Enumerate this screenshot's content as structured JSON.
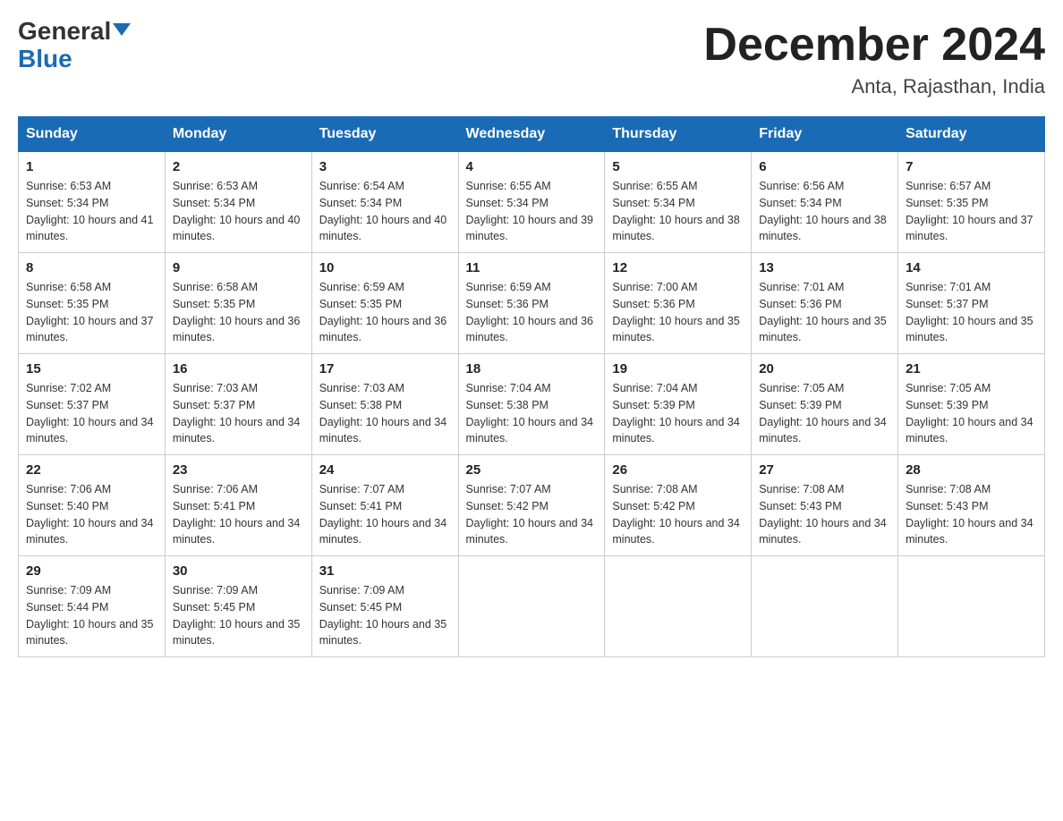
{
  "header": {
    "logo_general": "General",
    "logo_blue": "Blue",
    "month_title": "December 2024",
    "location": "Anta, Rajasthan, India"
  },
  "days_of_week": [
    "Sunday",
    "Monday",
    "Tuesday",
    "Wednesday",
    "Thursday",
    "Friday",
    "Saturday"
  ],
  "weeks": [
    [
      {
        "day": "1",
        "sunrise": "6:53 AM",
        "sunset": "5:34 PM",
        "daylight": "10 hours and 41 minutes."
      },
      {
        "day": "2",
        "sunrise": "6:53 AM",
        "sunset": "5:34 PM",
        "daylight": "10 hours and 40 minutes."
      },
      {
        "day": "3",
        "sunrise": "6:54 AM",
        "sunset": "5:34 PM",
        "daylight": "10 hours and 40 minutes."
      },
      {
        "day": "4",
        "sunrise": "6:55 AM",
        "sunset": "5:34 PM",
        "daylight": "10 hours and 39 minutes."
      },
      {
        "day": "5",
        "sunrise": "6:55 AM",
        "sunset": "5:34 PM",
        "daylight": "10 hours and 38 minutes."
      },
      {
        "day": "6",
        "sunrise": "6:56 AM",
        "sunset": "5:34 PM",
        "daylight": "10 hours and 38 minutes."
      },
      {
        "day": "7",
        "sunrise": "6:57 AM",
        "sunset": "5:35 PM",
        "daylight": "10 hours and 37 minutes."
      }
    ],
    [
      {
        "day": "8",
        "sunrise": "6:58 AM",
        "sunset": "5:35 PM",
        "daylight": "10 hours and 37 minutes."
      },
      {
        "day": "9",
        "sunrise": "6:58 AM",
        "sunset": "5:35 PM",
        "daylight": "10 hours and 36 minutes."
      },
      {
        "day": "10",
        "sunrise": "6:59 AM",
        "sunset": "5:35 PM",
        "daylight": "10 hours and 36 minutes."
      },
      {
        "day": "11",
        "sunrise": "6:59 AM",
        "sunset": "5:36 PM",
        "daylight": "10 hours and 36 minutes."
      },
      {
        "day": "12",
        "sunrise": "7:00 AM",
        "sunset": "5:36 PM",
        "daylight": "10 hours and 35 minutes."
      },
      {
        "day": "13",
        "sunrise": "7:01 AM",
        "sunset": "5:36 PM",
        "daylight": "10 hours and 35 minutes."
      },
      {
        "day": "14",
        "sunrise": "7:01 AM",
        "sunset": "5:37 PM",
        "daylight": "10 hours and 35 minutes."
      }
    ],
    [
      {
        "day": "15",
        "sunrise": "7:02 AM",
        "sunset": "5:37 PM",
        "daylight": "10 hours and 34 minutes."
      },
      {
        "day": "16",
        "sunrise": "7:03 AM",
        "sunset": "5:37 PM",
        "daylight": "10 hours and 34 minutes."
      },
      {
        "day": "17",
        "sunrise": "7:03 AM",
        "sunset": "5:38 PM",
        "daylight": "10 hours and 34 minutes."
      },
      {
        "day": "18",
        "sunrise": "7:04 AM",
        "sunset": "5:38 PM",
        "daylight": "10 hours and 34 minutes."
      },
      {
        "day": "19",
        "sunrise": "7:04 AM",
        "sunset": "5:39 PM",
        "daylight": "10 hours and 34 minutes."
      },
      {
        "day": "20",
        "sunrise": "7:05 AM",
        "sunset": "5:39 PM",
        "daylight": "10 hours and 34 minutes."
      },
      {
        "day": "21",
        "sunrise": "7:05 AM",
        "sunset": "5:39 PM",
        "daylight": "10 hours and 34 minutes."
      }
    ],
    [
      {
        "day": "22",
        "sunrise": "7:06 AM",
        "sunset": "5:40 PM",
        "daylight": "10 hours and 34 minutes."
      },
      {
        "day": "23",
        "sunrise": "7:06 AM",
        "sunset": "5:41 PM",
        "daylight": "10 hours and 34 minutes."
      },
      {
        "day": "24",
        "sunrise": "7:07 AM",
        "sunset": "5:41 PM",
        "daylight": "10 hours and 34 minutes."
      },
      {
        "day": "25",
        "sunrise": "7:07 AM",
        "sunset": "5:42 PM",
        "daylight": "10 hours and 34 minutes."
      },
      {
        "day": "26",
        "sunrise": "7:08 AM",
        "sunset": "5:42 PM",
        "daylight": "10 hours and 34 minutes."
      },
      {
        "day": "27",
        "sunrise": "7:08 AM",
        "sunset": "5:43 PM",
        "daylight": "10 hours and 34 minutes."
      },
      {
        "day": "28",
        "sunrise": "7:08 AM",
        "sunset": "5:43 PM",
        "daylight": "10 hours and 34 minutes."
      }
    ],
    [
      {
        "day": "29",
        "sunrise": "7:09 AM",
        "sunset": "5:44 PM",
        "daylight": "10 hours and 35 minutes."
      },
      {
        "day": "30",
        "sunrise": "7:09 AM",
        "sunset": "5:45 PM",
        "daylight": "10 hours and 35 minutes."
      },
      {
        "day": "31",
        "sunrise": "7:09 AM",
        "sunset": "5:45 PM",
        "daylight": "10 hours and 35 minutes."
      },
      null,
      null,
      null,
      null
    ]
  ],
  "labels": {
    "sunrise_prefix": "Sunrise: ",
    "sunset_prefix": "Sunset: ",
    "daylight_prefix": "Daylight: "
  }
}
